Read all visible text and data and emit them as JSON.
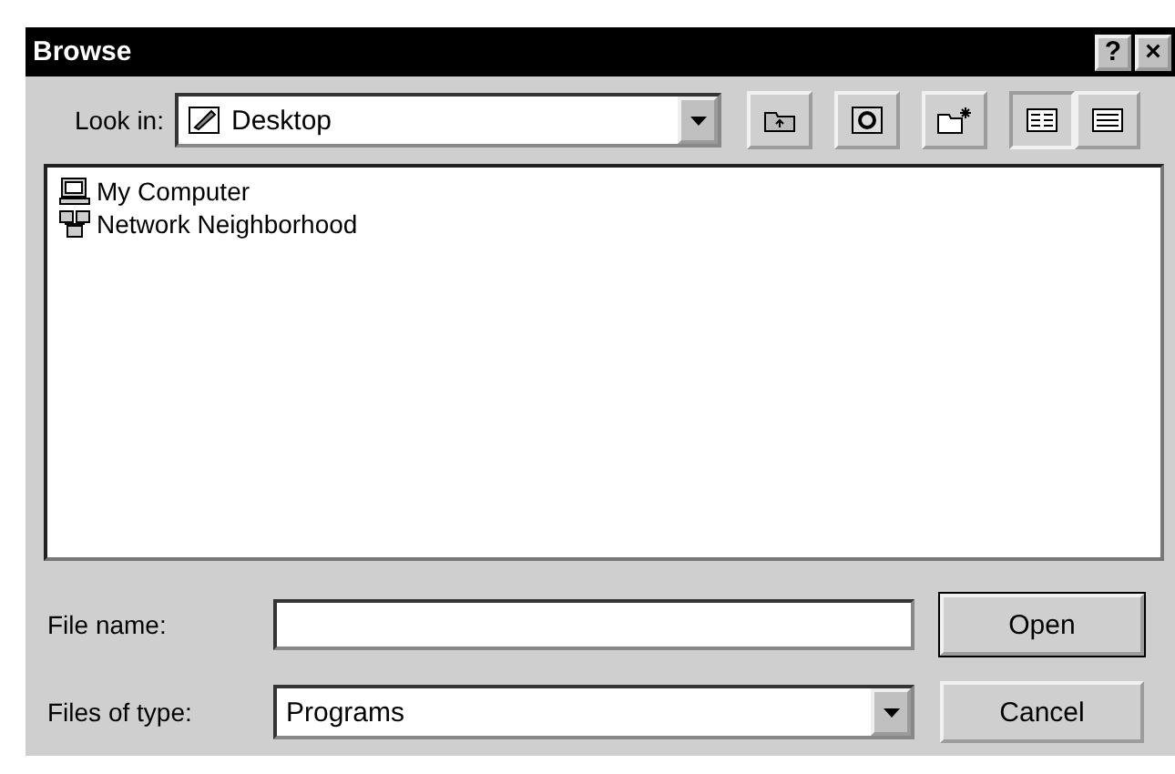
{
  "window": {
    "title": "Browse",
    "help_button": "?",
    "close_button": "×"
  },
  "look_in": {
    "label": "Look in:",
    "value": "Desktop"
  },
  "items": [
    {
      "label": "My Computer",
      "kind": "computer",
      "selected": false
    },
    {
      "label": "Network Neighborhood",
      "kind": "network",
      "selected": false
    }
  ],
  "file_name": {
    "label": "File name:"
  },
  "files_of_type": {
    "label": "Files of type:",
    "value": "Programs"
  },
  "buttons": [
    {
      "label": "Open",
      "default": true
    },
    {
      "label": "Cancel",
      "default": false
    }
  ]
}
